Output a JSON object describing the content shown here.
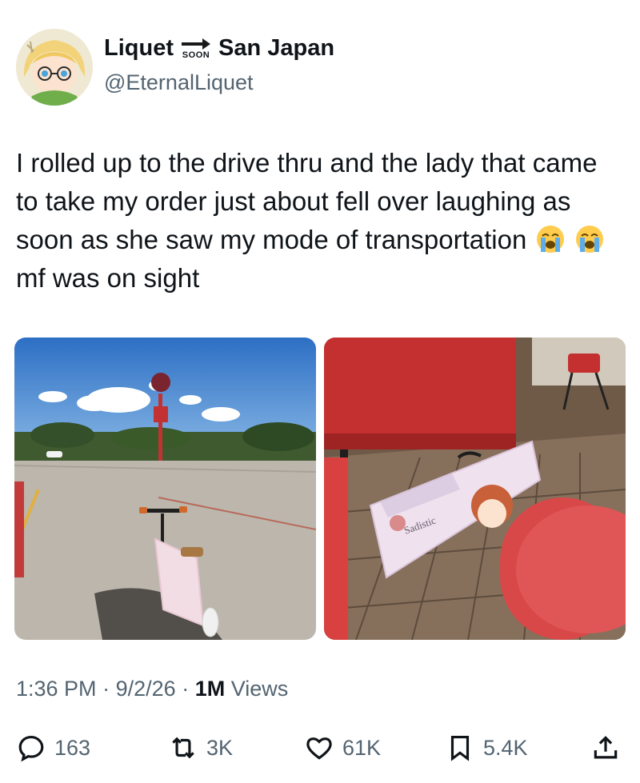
{
  "author": {
    "display_name_start": "Liquet",
    "arrow_sign_text": "SOON",
    "display_name_end": "San Japan",
    "handle": "@EternalLiquet",
    "avatar_icon": "anime-avatar-icon"
  },
  "tweet": {
    "text_before_emoji": "I rolled up to the drive thru and the lady that came to take my order just about fell over laughing as soon as she saw my mode of transportation",
    "emoji_name": "loudly-crying-face",
    "text_after_emoji": "mf was on sight"
  },
  "photos": [
    {
      "subject": "scooter in parking lot",
      "sign_text": ""
    },
    {
      "subject": "folded scooter in restaurant",
      "sticker_text": "Sadistic"
    }
  ],
  "meta": {
    "time": "1:36 PM",
    "separator": "·",
    "date": "9/2/26",
    "views_count": "1M",
    "views_label": "Views"
  },
  "actions": {
    "replies": "163",
    "reposts": "3K",
    "likes": "61K",
    "bookmarks": "5.4K"
  },
  "colors": {
    "text": "#0f1419",
    "secondary": "#536471"
  }
}
